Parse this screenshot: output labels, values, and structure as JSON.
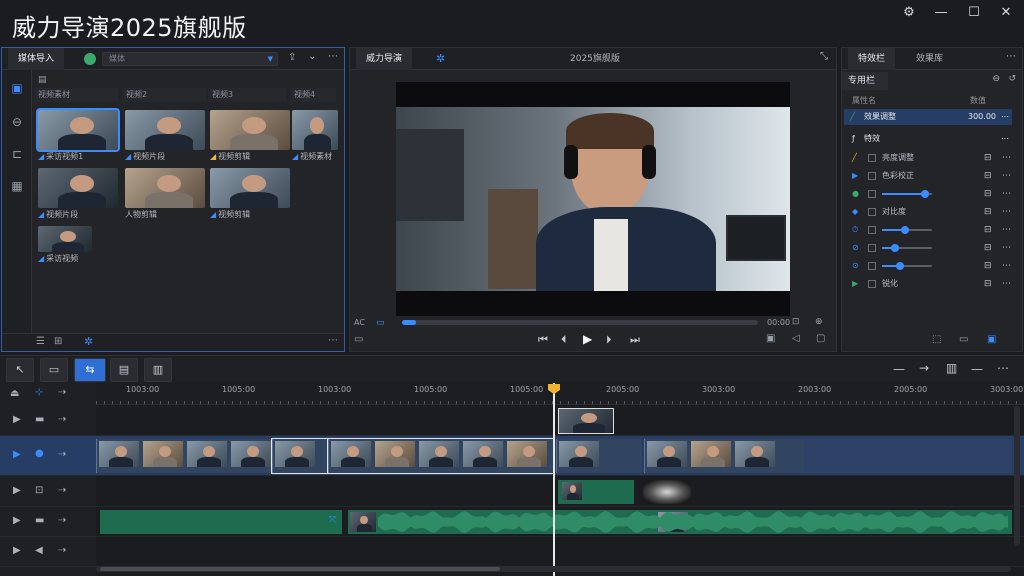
{
  "app_title": "威力导演2025旗舰版",
  "window_controls": {
    "settings": "⚙",
    "minimize": "—",
    "maximize": "☐",
    "close": "✕"
  },
  "media": {
    "tab_active": "媒体导入",
    "tab_search_placeholder": "媒体",
    "columns": [
      "视频素材",
      "视频2",
      "视频3",
      "视频4"
    ],
    "clips": [
      {
        "label": "采访视频1"
      },
      {
        "label": "视频片段"
      },
      {
        "label": "视频剪辑"
      },
      {
        "label": "视频素材"
      },
      {
        "label": "视频片段"
      },
      {
        "label": "人物剪辑"
      },
      {
        "label": "视频剪辑"
      },
      {
        "label": "采访视频"
      }
    ]
  },
  "viewer": {
    "tab_active": "威力导演",
    "title": "2025旗舰版",
    "timecode_left": "AC",
    "timecode_right": "00:00",
    "progress": 0.04
  },
  "inspector": {
    "tabs": [
      "特效栏",
      "效果库"
    ],
    "section_title": "专用栏",
    "header_cols": [
      "属性名",
      "数值"
    ],
    "selected_item": {
      "label": "效果调整",
      "value": "300.00"
    },
    "group_title": "特效",
    "rows": [
      {
        "label": "亮度调整"
      },
      {
        "label": "色彩校正"
      },
      {
        "label": "",
        "slider": 0.85
      },
      {
        "label": "对比度"
      },
      {
        "label": "",
        "slider": 0.45
      },
      {
        "label": "",
        "slider": 0.25
      },
      {
        "label": "",
        "slider": 0.35
      },
      {
        "label": "锐化"
      }
    ]
  },
  "timeline": {
    "ruler_labels": [
      "1003:00",
      "1005:00",
      "1003:00",
      "1005:00",
      "1005:00",
      "2005:00",
      "3003:00",
      "2003:00",
      "2005:00",
      "3003:00"
    ],
    "colors": {
      "accent": "#3b8cff",
      "audio": "#1f6b4f",
      "playhead_cap": "#f2b233"
    }
  }
}
